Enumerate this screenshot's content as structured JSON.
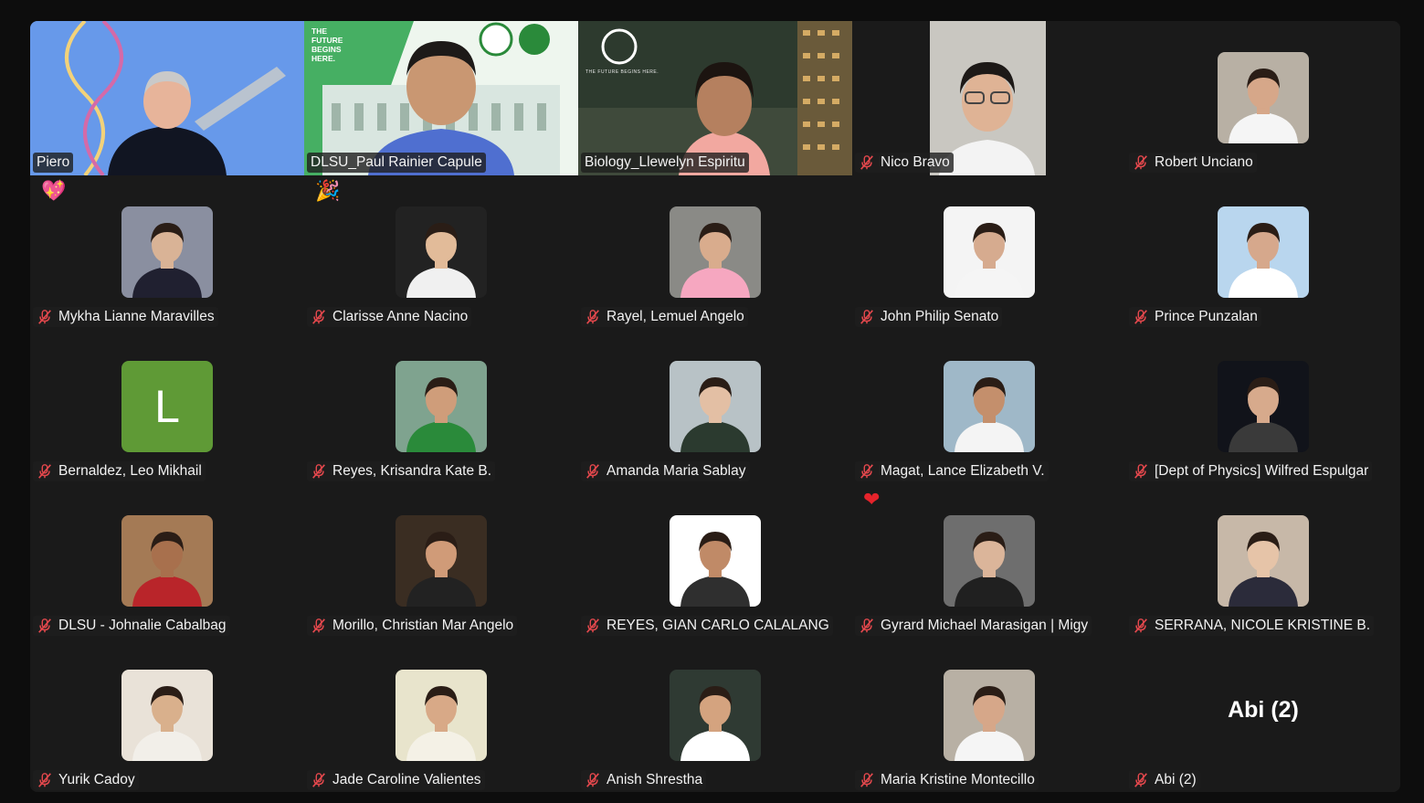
{
  "participants": [
    {
      "name": "Piero",
      "muted": false,
      "video": true,
      "active": false
    },
    {
      "name": "DLSU_Paul Rainier Capule",
      "muted": false,
      "video": true,
      "active": true
    },
    {
      "name": "Biology_Llewelyn Espiritu",
      "muted": false,
      "video": true,
      "active": false
    },
    {
      "name": "Nico Bravo",
      "muted": true,
      "video": true,
      "active": false
    },
    {
      "name": "Robert Unciano",
      "muted": true,
      "video": false
    },
    {
      "name": "Mykha Lianne Maravilles",
      "muted": true,
      "video": false,
      "reaction": "heart-sparkle"
    },
    {
      "name": "Clarisse Anne Nacino",
      "muted": true,
      "video": false,
      "reaction": "party-popper"
    },
    {
      "name": "Rayel, Lemuel Angelo",
      "muted": true,
      "video": false
    },
    {
      "name": "John Philip Senato",
      "muted": true,
      "video": false
    },
    {
      "name": "Prince Punzalan",
      "muted": true,
      "video": false
    },
    {
      "name": "Bernaldez, Leo Mikhail",
      "muted": true,
      "video": false,
      "initial": "L",
      "initial_color": "#5f9a36"
    },
    {
      "name": "Reyes, Krisandra Kate B.",
      "muted": true,
      "video": false
    },
    {
      "name": "Amanda Maria Sablay",
      "muted": true,
      "video": false
    },
    {
      "name": "Magat, Lance Elizabeth V.",
      "muted": true,
      "video": false
    },
    {
      "name": "[Dept of Physics] Wilfred Espulgar",
      "muted": true,
      "video": false
    },
    {
      "name": "DLSU - Johnalie Cabalbag",
      "muted": true,
      "video": false
    },
    {
      "name": "Morillo, Christian Mar Angelo",
      "muted": true,
      "video": false
    },
    {
      "name": "REYES, GIAN CARLO CALALANG",
      "muted": true,
      "video": false
    },
    {
      "name": "Gyrard Michael Marasigan | Migy",
      "muted": true,
      "video": false,
      "reaction": "heart"
    },
    {
      "name": "SERRANA, NICOLE KRISTINE B.",
      "muted": true,
      "video": false
    },
    {
      "name": "Yurik Cadoy",
      "muted": true,
      "video": false
    },
    {
      "name": "Jade Caroline Valientes",
      "muted": true,
      "video": false
    },
    {
      "name": "Anish Shrestha",
      "muted": true,
      "video": false
    },
    {
      "name": "Maria Kristine Montecillo",
      "muted": true,
      "video": false
    },
    {
      "name": "Abi (2)",
      "muted": true,
      "video": false,
      "no_photo": true,
      "display_name": "Abi (2)"
    }
  ],
  "banner": {
    "line1": "THE",
    "line2": "FUTURE",
    "line3": "BEGINS",
    "line4": "HERE.",
    "small": "THE FUTURE BEGINS HERE."
  },
  "colors": {
    "active_border": "#3ee07a",
    "tile_bg": "#1a1a1a",
    "muted_icon": "#e5484d"
  }
}
